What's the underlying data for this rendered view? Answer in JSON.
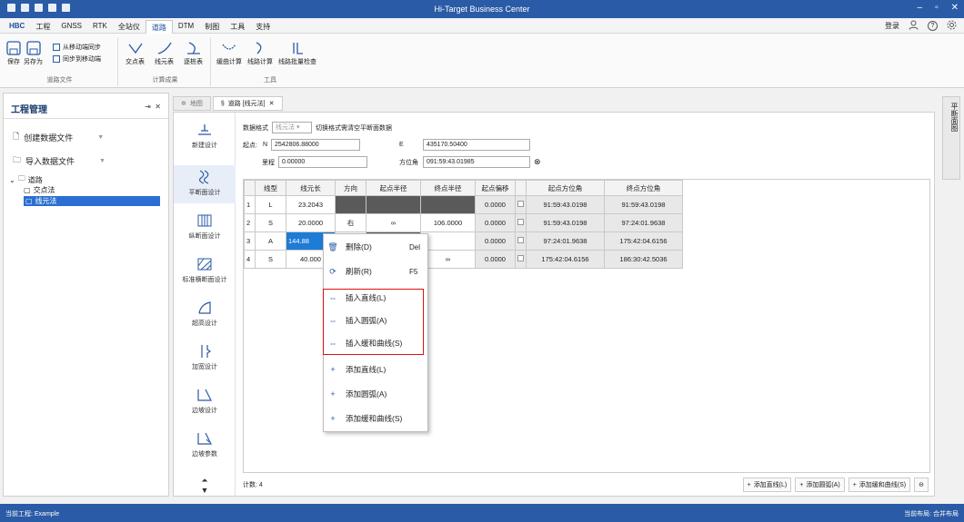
{
  "app": {
    "title": "Hi-Target Business Center"
  },
  "menubar": {
    "tabs": [
      "HBC",
      "工程",
      "GNSS",
      "RTK",
      "全站仪",
      "道路",
      "DTM",
      "制图",
      "工具",
      "支持"
    ],
    "active_tab": 5,
    "login": "登录"
  },
  "ribbon": {
    "save": "保存",
    "save_as": "另存为",
    "sync_from_mobile": "从移动端同步",
    "sync_to_mobile": "同步到移动端",
    "group_road_file": "道路文件",
    "intersection_table": "交点表",
    "element_table": "线元表",
    "chainage_table": "逐桩表",
    "group_calc_result": "计算成果",
    "curve_calc": "缓曲计算",
    "route_calc": "线路计算",
    "batch_check": "线路批量检查",
    "group_tools": "工具"
  },
  "left_panel": {
    "title": "工程管理",
    "create_data_file": "创建数据文件",
    "import_data_file": "导入数据文件",
    "tree_root": "道路",
    "tree_child_1": "交点法",
    "tree_child_2": "线元法"
  },
  "doc_tabs": {
    "map": "地图",
    "road": "道路 [线元法]"
  },
  "tools": {
    "new": "新建设计",
    "horizontal": "平断面设计",
    "vertical": "纵断面设计",
    "standard_cross": "标准横断面设计",
    "superelevation": "超高设计",
    "widening": "加宽设计",
    "slope": "边坡设计",
    "slope_params": "边坡参数"
  },
  "form": {
    "format_label": "数据格式",
    "format_value": "线元法",
    "clear_hint": "切换格式需清空平断面数据",
    "start_label": "起点:",
    "n_label": "N",
    "n_value": "2542806.88000",
    "e_label": "E",
    "e_value": "435170.50400",
    "station_label": "里程",
    "station_value": "0.00000",
    "azimuth_label": "方位角",
    "azimuth_value": "091:59:43.01985"
  },
  "table": {
    "headers": [
      "线型",
      "线元长",
      "方向",
      "起点半径",
      "终点半径",
      "起点偏移",
      "",
      "起点方位角",
      "终点方位角"
    ],
    "rows": [
      {
        "idx": "1",
        "type": "L",
        "length": "23.2043",
        "dir": "",
        "r1": "",
        "r2": "",
        "offset": "0.0000",
        "a1": "91:59:43.0198",
        "a2": "91:59:43.0198"
      },
      {
        "idx": "2",
        "type": "S",
        "length": "20.0000",
        "dir": "右",
        "r1": "∞",
        "r2": "106.0000",
        "offset": "0.0000",
        "a1": "91:59:43.0198",
        "a2": "97:24:01.9638"
      },
      {
        "idx": "3",
        "type": "A",
        "length": "144.88",
        "dir": "",
        "r1": "",
        "r2": "",
        "offset": "0.0000",
        "a1": "97:24:01.9638",
        "a2": "175:42:04.6156"
      },
      {
        "idx": "4",
        "type": "S",
        "length": "40.000",
        "dir": "",
        "r1": "",
        "r2": "∞",
        "offset": "0.0000",
        "a1": "175:42:04.6156",
        "a2": "186:30:42.5036"
      }
    ]
  },
  "context_menu": {
    "delete": "删除(D)",
    "delete_key": "Del",
    "refresh": "刷新(R)",
    "refresh_key": "F5",
    "insert_line": "插入直线(L)",
    "insert_arc": "插入圆弧(A)",
    "insert_spiral": "插入缓和曲线(S)",
    "add_line": "添加直线(L)",
    "add_arc": "添加圆弧(A)",
    "add_spiral": "添加缓和曲线(S)"
  },
  "footer": {
    "count": "计数: 4",
    "add_line": "添加直线(L)",
    "add_arc": "添加圆弧(A)",
    "add_spiral": "添加缓和曲线(S)"
  },
  "right_strip": "平断面图",
  "status": {
    "left": "当前工程: Example",
    "right": "当前布局: 合并布局"
  },
  "colors": {
    "title_bar": "#2a5ba6",
    "selection": "#1e7bd6",
    "highlight_box": "#d11111"
  }
}
